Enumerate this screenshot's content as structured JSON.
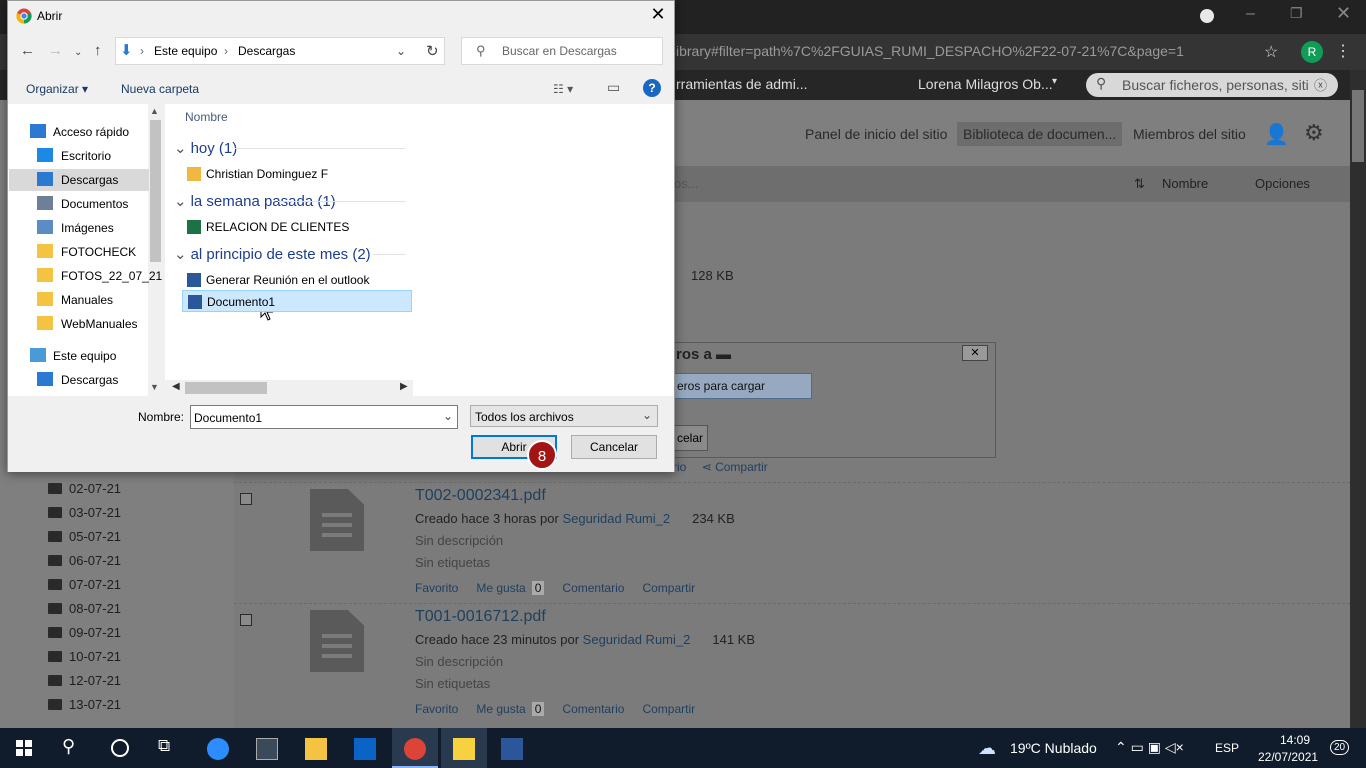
{
  "browser": {
    "address": "ibrary#filter=path%7C%2FGUIAS_RUMI_DESPACHO%2F22-07-21%7C&page=1",
    "profile_initial": "R"
  },
  "sharepoint": {
    "topbar_left": "rramientas de admi...",
    "user": "Lorena Milagros Ob...",
    "search_placeholder": "Buscar ficheros, personas, siti",
    "nav": [
      "Panel de inicio del sitio",
      "Biblioteca de documen...",
      "Miembros del sitio"
    ],
    "toolbar_trunc": "os...",
    "toolbar_sort": "Nombre",
    "toolbar_options": "Opciones",
    "size_top": "128 KB",
    "folders": [
      "02-07-21",
      "03-07-21",
      "05-07-21",
      "06-07-21",
      "07-07-21",
      "08-07-21",
      "09-07-21",
      "10-07-21",
      "12-07-21",
      "13-07-21"
    ],
    "files": [
      {
        "name": "T002-0002341.pdf",
        "created": "Creado hace 3 horas por",
        "author": "Seguridad Rumi_2",
        "size": "234 KB",
        "desc": "Sin descripción",
        "tags": "Sin etiquetas",
        "likes": "0"
      },
      {
        "name": "T001-0016712.pdf",
        "created": "Creado hace 23 minutos por",
        "author": "Seguridad Rumi_2",
        "size": "141 KB",
        "desc": "Sin descripción",
        "tags": "Sin etiquetas",
        "likes": "0"
      }
    ],
    "actions": {
      "fav": "Favorito",
      "like": "Me gusta",
      "comment": "Comentario",
      "share": "Compartir"
    },
    "top_actions": {
      "fav": "rio",
      "share": "Compartir"
    },
    "upload": {
      "title": "ros a",
      "button": "eros para cargar",
      "cancel": "celar"
    }
  },
  "dialog": {
    "title": "Abrir",
    "path": [
      "Este equipo",
      "Descargas"
    ],
    "search_placeholder": "Buscar en Descargas",
    "organize": "Organizar",
    "new_folder": "Nueva carpeta",
    "column": "Nombre",
    "nav_items": [
      {
        "label": "Acceso rápido",
        "icon": "star-icon"
      },
      {
        "label": "Escritorio",
        "icon": "desktop-icon"
      },
      {
        "label": "Descargas",
        "icon": "download-icon"
      },
      {
        "label": "Documentos",
        "icon": "document-icon"
      },
      {
        "label": "Imágenes",
        "icon": "image-icon"
      },
      {
        "label": "FOTOCHECK",
        "icon": "folder-icon"
      },
      {
        "label": "FOTOS_22_07_21",
        "icon": "folder-icon"
      },
      {
        "label": "Manuales",
        "icon": "folder-icon"
      },
      {
        "label": "WebManuales",
        "icon": "folder-icon"
      },
      {
        "label": "Este equipo",
        "icon": "computer-icon"
      },
      {
        "label": "Descargas",
        "icon": "download-icon"
      }
    ],
    "groups": [
      {
        "label": "hoy (1)",
        "files": [
          {
            "name": "Christian Dominguez F",
            "icon": "zip-file-icon"
          }
        ]
      },
      {
        "label": "la semana pasada (1)",
        "files": [
          {
            "name": "RELACION DE CLIENTES",
            "icon": "excel-file-icon"
          }
        ]
      },
      {
        "label": "al principio de este mes (2)",
        "files": [
          {
            "name": "Generar Reunión en el outlook",
            "icon": "word-file-icon"
          },
          {
            "name": "Documento1",
            "icon": "word-file-icon"
          }
        ]
      }
    ],
    "name_label": "Nombre:",
    "name_value": "Documento1",
    "file_type": "Todos los archivos",
    "open_button": "Abrir",
    "cancel_button": "Cancelar",
    "step_badge": "8"
  },
  "taskbar": {
    "weather": "19ºC  Nublado",
    "lang": "ESP",
    "time": "14:09",
    "date": "22/07/2021",
    "notifications": "20"
  },
  "colors": {
    "accent": "#0078d7",
    "badge": "#a31515",
    "link": "#1e3d8c"
  }
}
